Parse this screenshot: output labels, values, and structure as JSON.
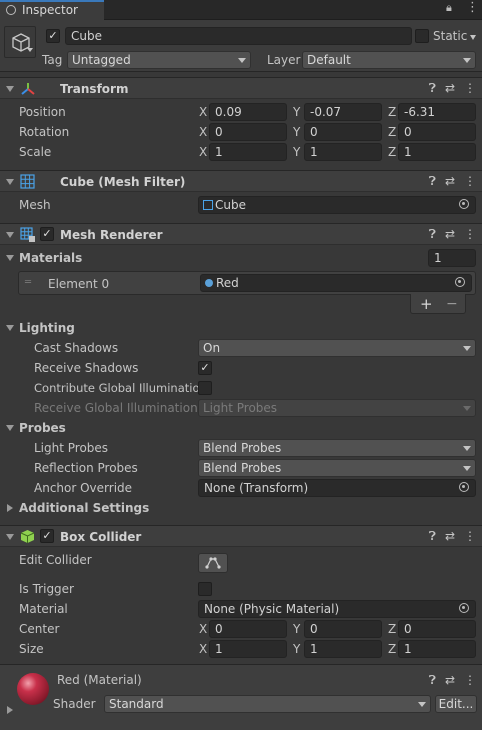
{
  "tab": {
    "title": "Inspector"
  },
  "object": {
    "active": "✓",
    "name": "Cube",
    "static_label": "Static",
    "tag_label": "Tag",
    "tag_value": "Untagged",
    "layer_label": "Layer",
    "layer_value": "Default"
  },
  "transform": {
    "title": "Transform",
    "position": {
      "label": "Position",
      "x": "0.09",
      "y": "-0.07",
      "z": "-6.31"
    },
    "rotation": {
      "label": "Rotation",
      "x": "0",
      "y": "0",
      "z": "0"
    },
    "scale": {
      "label": "Scale",
      "x": "1",
      "y": "1",
      "z": "1"
    }
  },
  "axis": {
    "x": "X",
    "y": "Y",
    "z": "Z"
  },
  "mesh_filter": {
    "title": "Cube (Mesh Filter)",
    "mesh_label": "Mesh",
    "mesh_value": "Cube"
  },
  "mesh_renderer": {
    "title": "Mesh Renderer",
    "enabled": "✓",
    "materials_label": "Materials",
    "materials_count": "1",
    "element_label": "Element 0",
    "element_value": "Red",
    "add": "+",
    "remove": "−",
    "lighting_label": "Lighting",
    "cast_shadows_label": "Cast Shadows",
    "cast_shadows_value": "On",
    "receive_shadows_label": "Receive Shadows",
    "receive_shadows_value": "✓",
    "contribute_gi_label": "Contribute Global Illumination",
    "receive_gi_label": "Receive Global Illumination",
    "receive_gi_value": "Light Probes",
    "probes_label": "Probes",
    "light_probes_label": "Light Probes",
    "light_probes_value": "Blend Probes",
    "reflection_probes_label": "Reflection Probes",
    "reflection_probes_value": "Blend Probes",
    "anchor_label": "Anchor Override",
    "anchor_value": "None (Transform)",
    "additional_label": "Additional Settings"
  },
  "box_collider": {
    "title": "Box Collider",
    "enabled": "✓",
    "edit_label": "Edit Collider",
    "trigger_label": "Is Trigger",
    "material_label": "Material",
    "material_value": "None (Physic Material)",
    "center": {
      "label": "Center",
      "x": "0",
      "y": "0",
      "z": "0"
    },
    "size": {
      "label": "Size",
      "x": "1",
      "y": "1",
      "z": "1"
    }
  },
  "material": {
    "title": "Red (Material)",
    "shader_label": "Shader",
    "shader_value": "Standard",
    "edit_label": "Edit..."
  },
  "colors": {
    "background": "#383838",
    "header": "#3e3e3e",
    "field": "#2a2a2a",
    "dropdown": "#515151",
    "material_sphere": "#b0243c",
    "collider_icon": "#8fd14f"
  }
}
